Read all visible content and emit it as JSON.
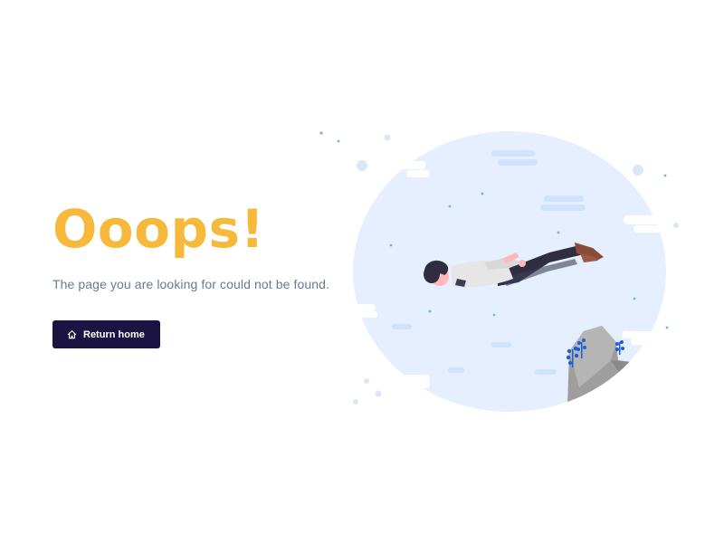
{
  "error": {
    "headline": "Ooops!",
    "message": "The page you are looking for could not be found."
  },
  "actions": {
    "return_home_label": "Return home",
    "return_home_icon": "home-icon"
  },
  "colors": {
    "headline": "#f7b93c",
    "message": "#6b7a8d",
    "button_bg": "#1b1442",
    "illustration_bg": "#e6efff"
  }
}
